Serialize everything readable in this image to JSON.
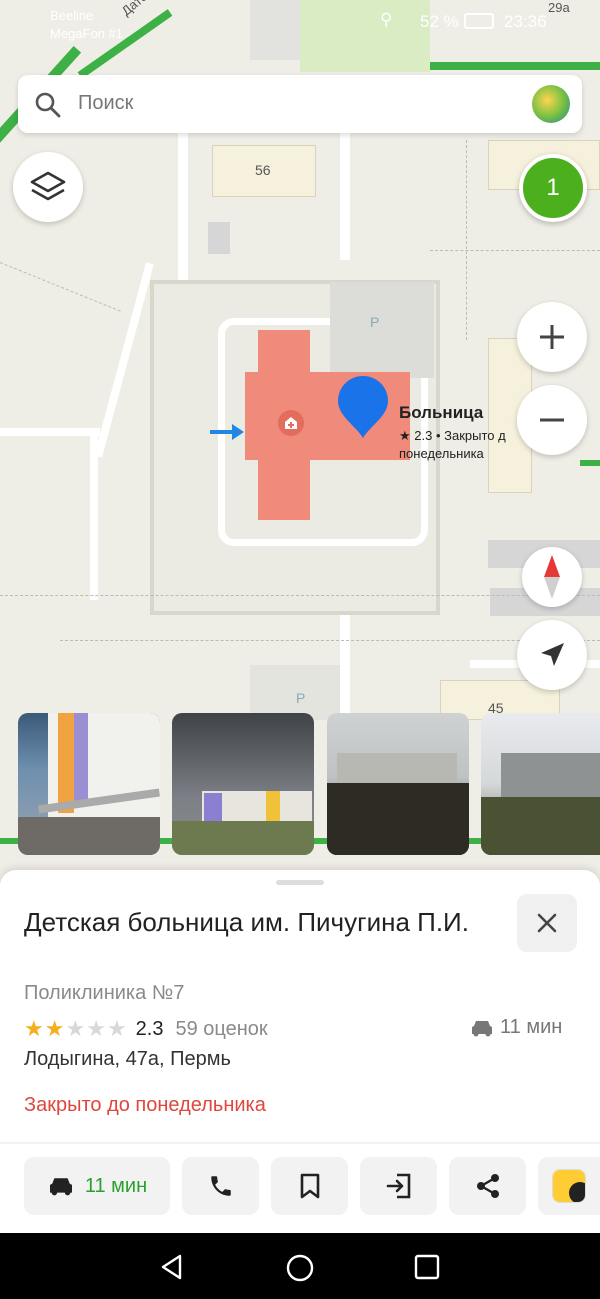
{
  "status_bar": {
    "carrier1": "Beeline",
    "carrier2": "MegaFon #1",
    "battery": "52 %",
    "time": "23:36"
  },
  "search": {
    "placeholder": "Поиск"
  },
  "map": {
    "building_numbers": [
      "56",
      "29a",
      "45"
    ],
    "parking_label": "P",
    "poi_name": "Больница",
    "poi_rating_line": "★ 2.3 • Закрыто д",
    "poi_rating_line2": "понедельника",
    "cluster_count": "1",
    "edge_label_left": "Дато"
  },
  "sheet": {
    "title": "Детская больница им. Пичугина П.И.",
    "category": "Поликлиника №7",
    "rating_value": "2.3",
    "rating_stars": 2,
    "reviews": "59 оценок",
    "drive_time": "11 мин",
    "address": "Лодыгина, 47а, Пермь",
    "hours": "Закрыто до понедельника"
  },
  "actions": {
    "route_time": "11 мин"
  },
  "colors": {
    "accent_green": "#2aa12e",
    "closed_red": "#e0463c",
    "pin_blue": "#1a73e8",
    "building_red": "#f08a7a",
    "cluster_green": "#4caf1d"
  }
}
